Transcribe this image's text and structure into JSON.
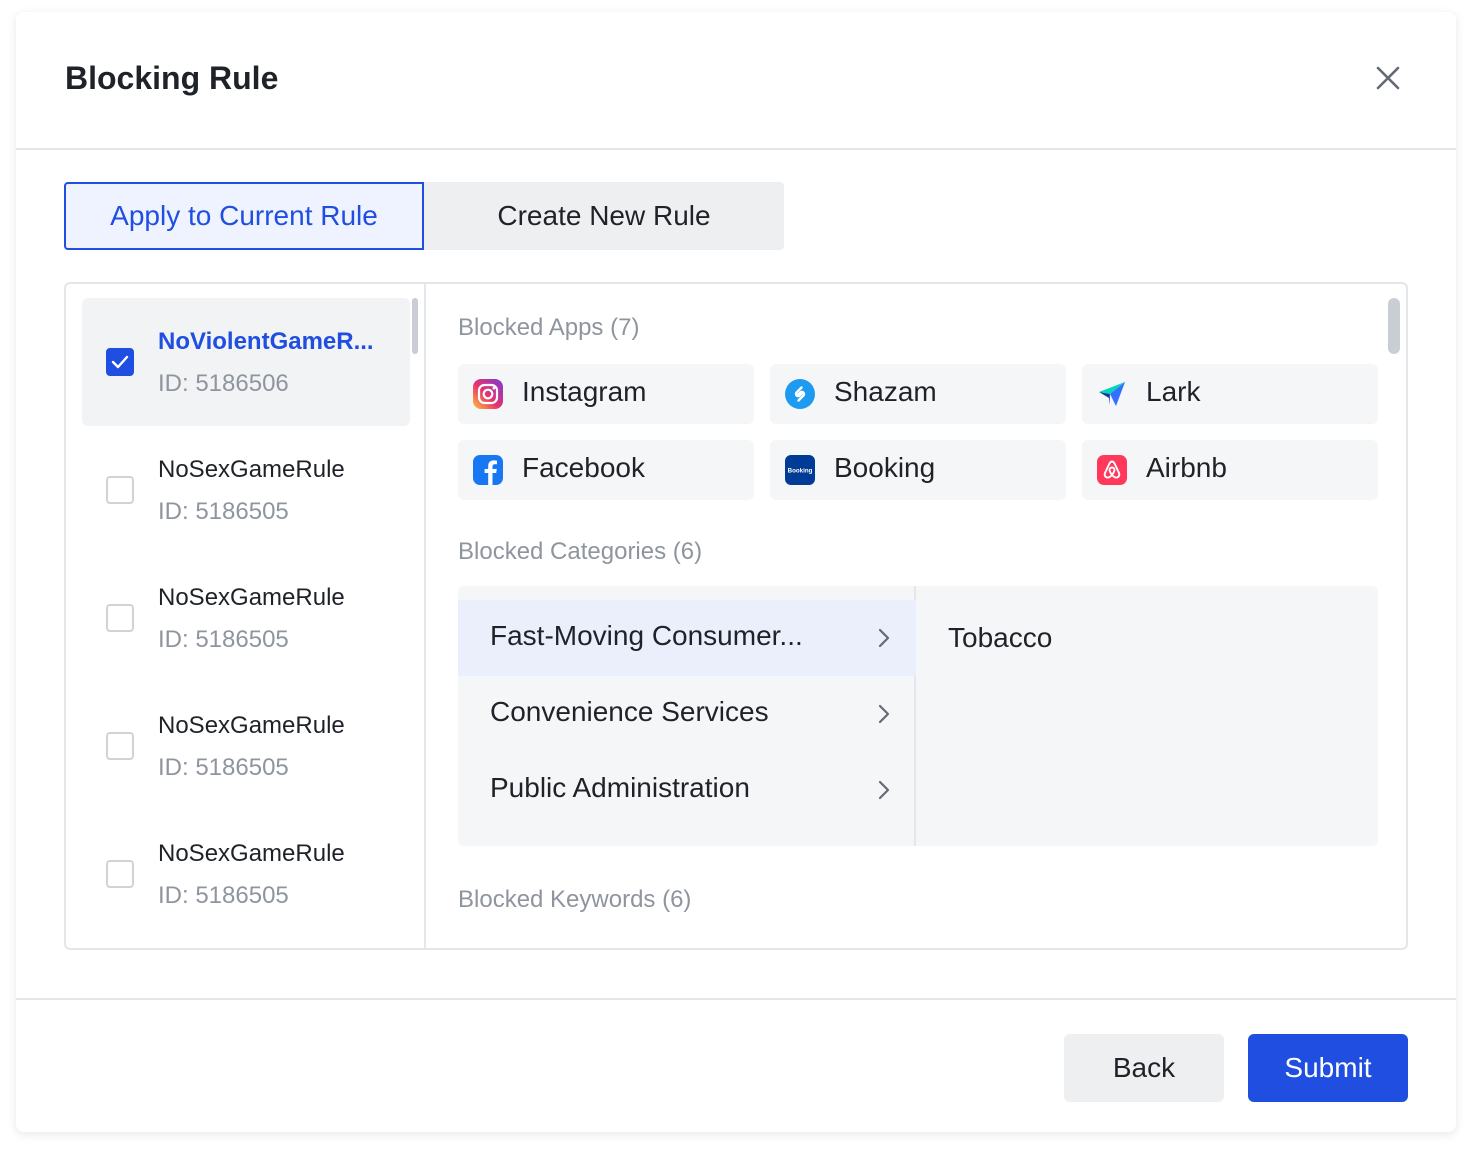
{
  "modal": {
    "title": "Blocking Rule"
  },
  "tabs": {
    "apply_current": "Apply to Current Rule",
    "create_new": "Create New Rule"
  },
  "rules": [
    {
      "name": "NoViolentGameR...",
      "id": "ID: 5186506",
      "checked": true
    },
    {
      "name": "NoSexGameRule",
      "id": "ID: 5186505",
      "checked": false
    },
    {
      "name": "NoSexGameRule",
      "id": "ID: 5186505",
      "checked": false
    },
    {
      "name": "NoSexGameRule",
      "id": "ID: 5186505",
      "checked": false
    },
    {
      "name": "NoSexGameRule",
      "id": "ID: 5186505",
      "checked": false
    }
  ],
  "blocked_apps": {
    "title": "Blocked Apps (7)",
    "items": [
      {
        "label": "Instagram",
        "icon": "instagram-icon"
      },
      {
        "label": "Shazam",
        "icon": "shazam-icon"
      },
      {
        "label": "Lark",
        "icon": "lark-icon"
      },
      {
        "label": "Facebook",
        "icon": "facebook-icon"
      },
      {
        "label": "Booking",
        "icon": "booking-icon",
        "icon_text": "Booking"
      },
      {
        "label": "Airbnb",
        "icon": "airbnb-icon"
      }
    ]
  },
  "blocked_categories": {
    "title": "Blocked Categories (6)",
    "items": [
      {
        "label": "Fast-Moving Consumer..."
      },
      {
        "label": "Convenience Services"
      },
      {
        "label": "Public Administration"
      }
    ],
    "subcategory": "Tobacco"
  },
  "blocked_keywords": {
    "title": "Blocked Keywords (6)"
  },
  "footer": {
    "back": "Back",
    "submit": "Submit"
  },
  "colors": {
    "accent": "#1f4ee0",
    "muted_text": "#8f959e",
    "border": "#e5e6eb"
  }
}
